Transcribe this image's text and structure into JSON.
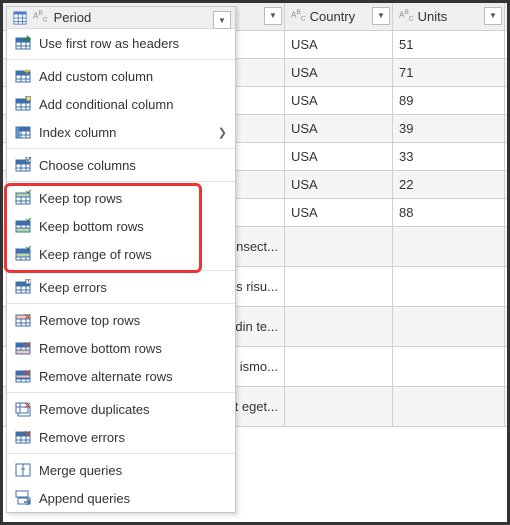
{
  "columns": {
    "period": "Period",
    "country": "Country",
    "units": "Units"
  },
  "rows": [
    {
      "period": "",
      "country": "USA",
      "units": "51"
    },
    {
      "period": "",
      "country": "USA",
      "units": "71"
    },
    {
      "period": "",
      "country": "USA",
      "units": "89"
    },
    {
      "period": "",
      "country": "USA",
      "units": "39"
    },
    {
      "period": "",
      "country": "USA",
      "units": "33"
    },
    {
      "period": "",
      "country": "USA",
      "units": "22"
    },
    {
      "period": "",
      "country": "USA",
      "units": "88"
    },
    {
      "period": "consect...",
      "country": "",
      "units": ""
    },
    {
      "period": "us risu...",
      "country": "",
      "units": ""
    },
    {
      "period": "din te...",
      "country": "",
      "units": ""
    },
    {
      "period": "ismo...",
      "country": "",
      "units": ""
    },
    {
      "period": "t eget...",
      "country": "",
      "units": ""
    }
  ],
  "tall_rows": [
    7,
    8,
    9,
    10,
    11
  ],
  "menu": {
    "header": "Period",
    "groups": [
      [
        {
          "icon": "headers",
          "label": "Use first row as headers"
        }
      ],
      [
        {
          "icon": "addcol",
          "label": "Add custom column"
        },
        {
          "icon": "condcol",
          "label": "Add conditional column"
        },
        {
          "icon": "indexcol",
          "label": "Index column",
          "sub": true
        }
      ],
      [
        {
          "icon": "choose",
          "label": "Choose columns"
        }
      ],
      [
        {
          "icon": "keeptop",
          "label": "Keep top rows"
        },
        {
          "icon": "keepbot",
          "label": "Keep bottom rows"
        },
        {
          "icon": "keeprange",
          "label": "Keep range of rows"
        }
      ],
      [
        {
          "icon": "keeperr",
          "label": "Keep errors"
        }
      ],
      [
        {
          "icon": "remtop",
          "label": "Remove top rows"
        },
        {
          "icon": "rembot",
          "label": "Remove bottom rows"
        },
        {
          "icon": "remalt",
          "label": "Remove alternate rows"
        }
      ],
      [
        {
          "icon": "remdup",
          "label": "Remove duplicates"
        },
        {
          "icon": "remerr",
          "label": "Remove errors"
        }
      ],
      [
        {
          "icon": "merge",
          "label": "Merge queries"
        },
        {
          "icon": "append",
          "label": "Append queries"
        }
      ]
    ]
  }
}
